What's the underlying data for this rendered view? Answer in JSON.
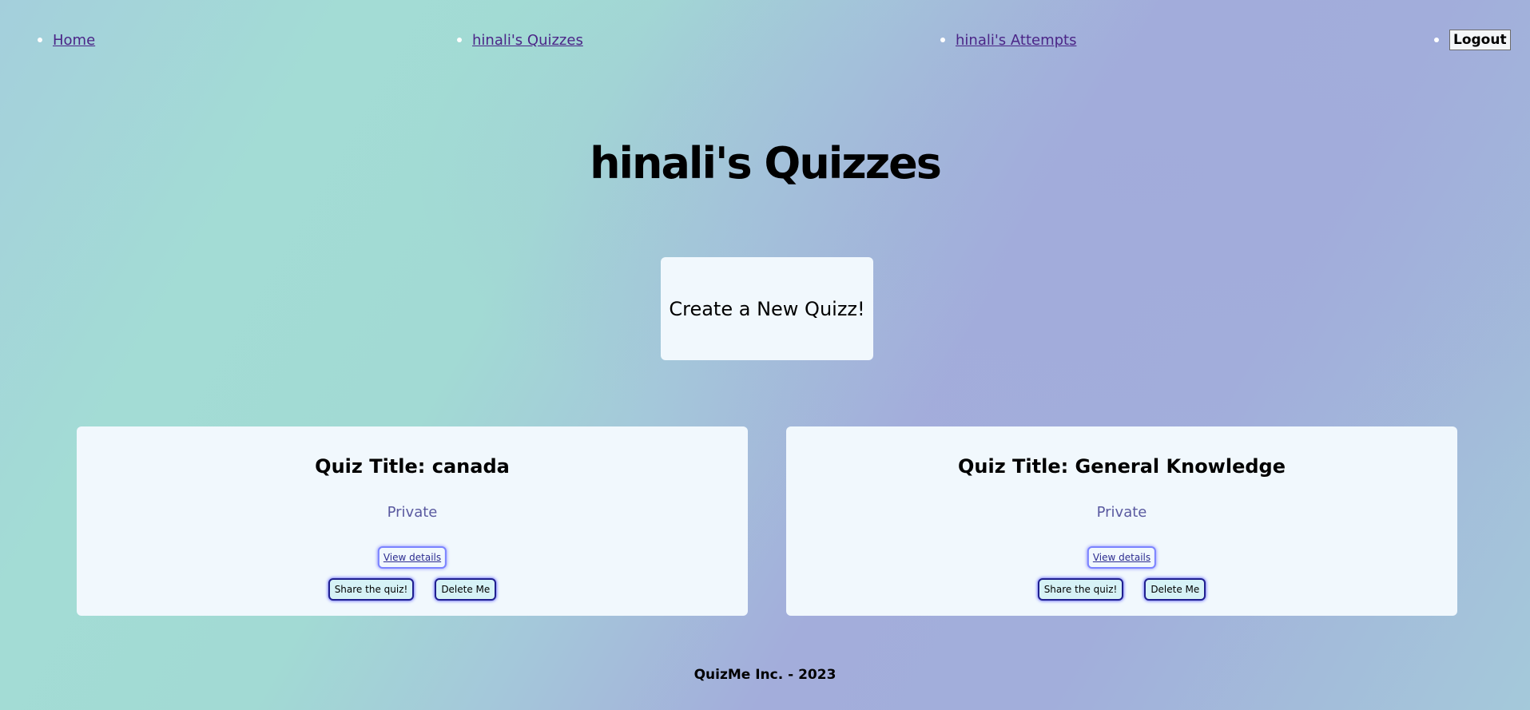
{
  "nav": {
    "home_label": "Home",
    "quizzes_label": "hinali's Quizzes",
    "attempts_label": "hinali's Attempts",
    "logout_label": "Logout"
  },
  "page": {
    "title": "hinali's Quizzes",
    "create_label": "Create a New Quizz!"
  },
  "quizzes": [
    {
      "title": "Quiz Title: canada",
      "privacy": "Private",
      "view_label": "View details",
      "share_label": "Share the quiz!",
      "delete_label": "Delete Me"
    },
    {
      "title": "Quiz Title: General Knowledge",
      "privacy": "Private",
      "view_label": "View details",
      "share_label": "Share the quiz!",
      "delete_label": "Delete Me"
    }
  ],
  "footer": {
    "text": "QuizMe Inc. - 2023"
  },
  "colors": {
    "link": "#4b2587",
    "card_bg": "#f1f8fd",
    "privacy_text": "#5a5aa0",
    "view_border": "#7b84ff",
    "action_border": "#20208f"
  }
}
